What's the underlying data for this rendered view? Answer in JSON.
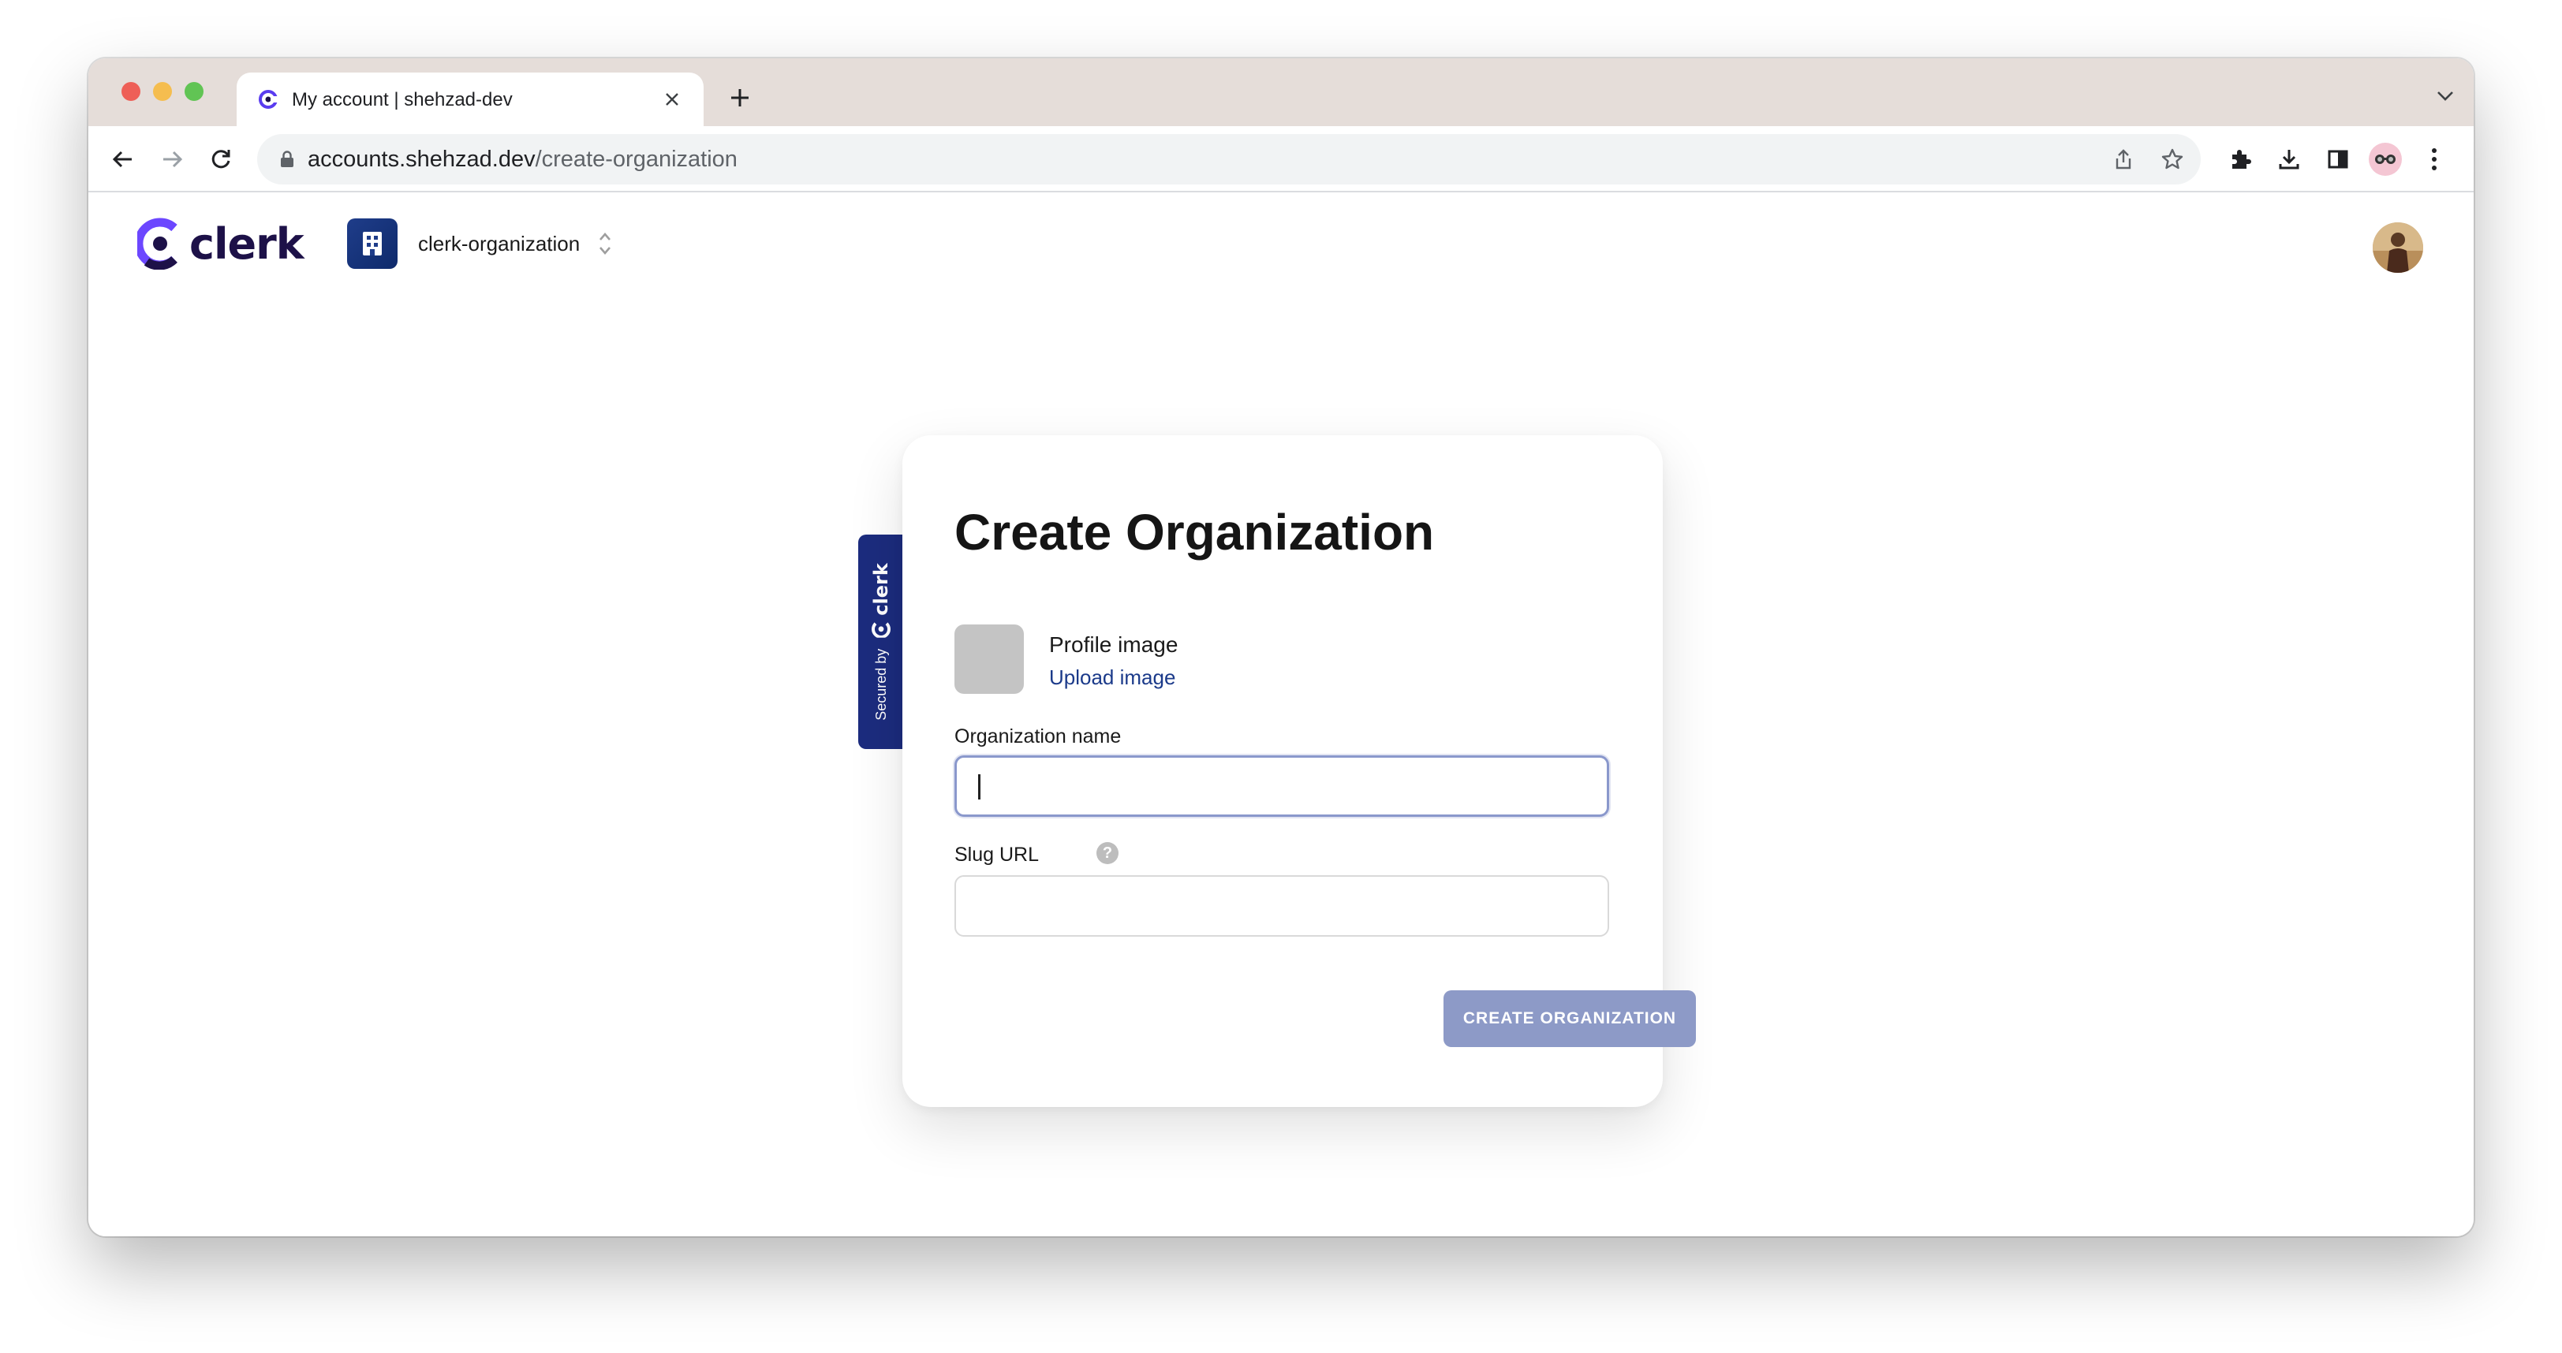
{
  "browser": {
    "tab_title": "My account | shehzad-dev",
    "url_host": "accounts.shehzad.dev",
    "url_path": "/create-organization"
  },
  "header": {
    "brand_name": "clerk",
    "org_name": "clerk-organization"
  },
  "secured_badge": {
    "text": "Secured by",
    "brand": "clerk"
  },
  "form": {
    "title": "Create Organization",
    "profile_image_label": "Profile image",
    "upload_link": "Upload image",
    "org_name_label": "Organization name",
    "org_name_value": "",
    "slug_label": "Slug URL",
    "slug_value": "",
    "help_icon": "?",
    "submit_label": "CREATE ORGANIZATION"
  },
  "colors": {
    "brand_navy": "#1d1148",
    "badge_blue": "#1c2c7e",
    "button_disabled": "#8d9ac7",
    "link_blue": "#1b3a8a"
  },
  "icons": {
    "back": "arrow-left-icon",
    "forward": "arrow-right-icon",
    "reload": "reload-icon",
    "share": "share-icon",
    "bookmark": "star-icon",
    "extensions": "puzzle-icon",
    "downloads": "download-icon",
    "sidepanel": "sidepanel-icon",
    "menu": "kebab-menu-icon"
  }
}
